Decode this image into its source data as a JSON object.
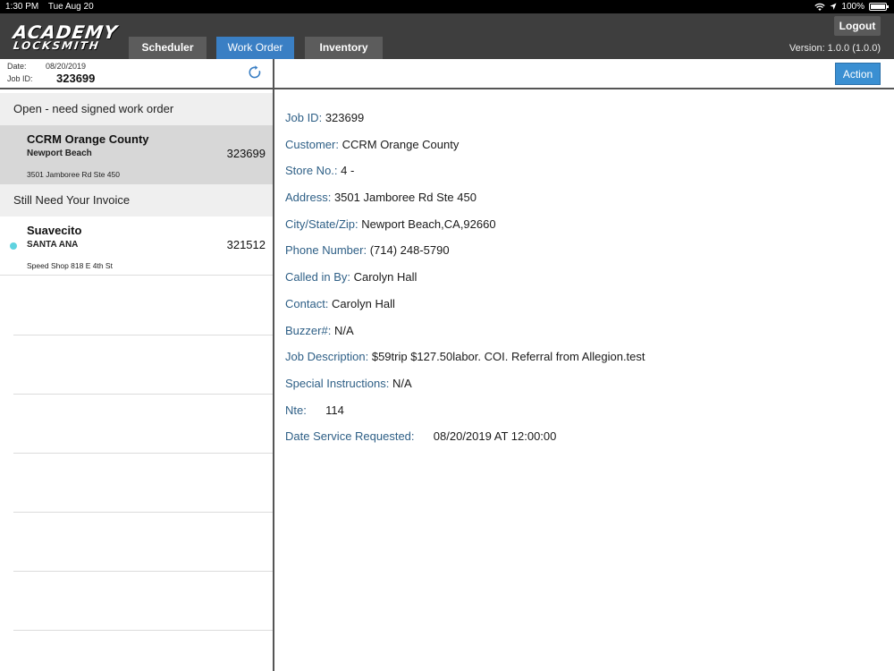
{
  "status_bar": {
    "time": "1:30 PM",
    "date": "Tue Aug 20",
    "battery": "100%"
  },
  "header": {
    "logo_line1": "ACADEMY",
    "logo_line2": "LOCKSMITH",
    "tabs": [
      {
        "label": "Scheduler",
        "active": false
      },
      {
        "label": "Work Order",
        "active": true
      },
      {
        "label": "Inventory",
        "active": false
      }
    ],
    "logout_label": "Logout",
    "version": "Version: 1.0.0 (1.0.0)"
  },
  "sidebar": {
    "date_label": "Date:",
    "date_value": "08/20/2019",
    "job_label": "Job ID:",
    "job_value": "323699",
    "sections": [
      {
        "title": "Open - need signed work order",
        "items": [
          {
            "name": "CCRM Orange County",
            "city": "Newport Beach",
            "number": "323699",
            "address": "3501 Jamboree Rd Ste 450",
            "selected": true
          }
        ]
      },
      {
        "title": "Still Need Your Invoice",
        "items": [
          {
            "name": "Suavecito",
            "city": "SANTA ANA",
            "number": "321512",
            "address": "Speed Shop 818 E 4th St",
            "unread": true
          }
        ]
      }
    ]
  },
  "detail": {
    "action_label": "Action",
    "fields": [
      {
        "label": "Job ID:",
        "value": "323699"
      },
      {
        "label": "Customer:",
        "value": "CCRM Orange County"
      },
      {
        "label": "Store No.:",
        "value": "4 -"
      },
      {
        "label": "Address:",
        "value": "3501 Jamboree Rd Ste 450"
      },
      {
        "label": "City/State/Zip:",
        "value": "Newport Beach,CA,92660"
      },
      {
        "label": "Phone Number:",
        "value": "(714) 248-5790"
      },
      {
        "label": "Called in By:",
        "value": "Carolyn Hall"
      },
      {
        "label": "Contact:",
        "value": "Carolyn Hall"
      },
      {
        "label": "Buzzer#:",
        "value": "N/A"
      },
      {
        "label": "Job Description:",
        "value": "$59trip $127.50labor. COI. Referral from Allegion.test"
      },
      {
        "label": "Special Instructions:",
        "value": "N/A"
      },
      {
        "label": "Nte:",
        "value": "114"
      },
      {
        "label": "Date Service Requested:",
        "value": "08/20/2019 AT 12:00:00"
      }
    ]
  },
  "colors": {
    "header_bg": "#3e3e3e",
    "active_tab": "#3a7fc4",
    "label_blue": "#2e5f86",
    "action_button": "#3a8fd2",
    "unread_dot": "#5fd3e0"
  }
}
